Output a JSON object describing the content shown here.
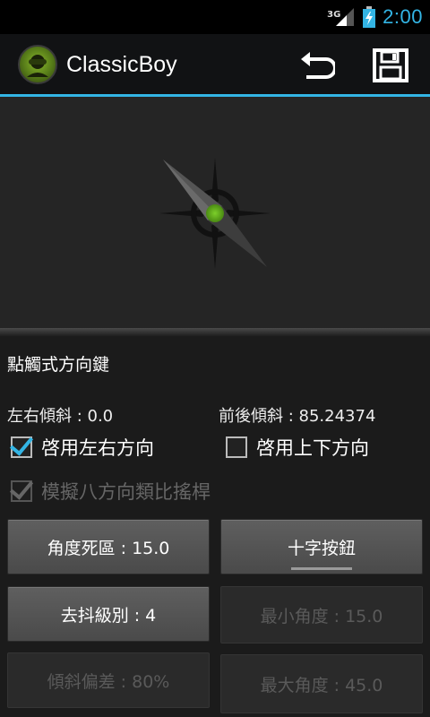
{
  "status_bar": {
    "network": "3G",
    "time": "2:00",
    "accent_color": "#33b5e5"
  },
  "action_bar": {
    "title": "ClassicBoy",
    "icons": [
      "app-icon",
      "undo-icon",
      "save-icon"
    ],
    "accent_color": "#33b5e5"
  },
  "settings": {
    "section_title": "點觸式方向鍵",
    "lr_tilt": "左右傾斜 : 0.0",
    "fb_tilt": "前後傾斜 : 85.24374",
    "checkboxes": {
      "enable_lr": {
        "label": "啓用左右方向",
        "checked": true,
        "enabled": true
      },
      "enable_ud": {
        "label": "啓用上下方向",
        "checked": false,
        "enabled": true
      },
      "eight_way": {
        "label": "模擬八方向類比搖桿",
        "checked": true,
        "enabled": false
      }
    },
    "buttons": {
      "dead_zone": {
        "label": "角度死區 : 15.0",
        "enabled": true
      },
      "cross_button": {
        "label": "十字按鈕",
        "enabled": true
      },
      "debounce": {
        "label": "去抖級別 : 4",
        "enabled": true
      },
      "min_angle": {
        "label": "最小角度 : 15.0",
        "enabled": false
      },
      "tilt_offset": {
        "label": "傾斜偏差 : 80%",
        "enabled": false
      },
      "max_angle": {
        "label": "最大角度 : 45.0",
        "enabled": false
      }
    }
  }
}
